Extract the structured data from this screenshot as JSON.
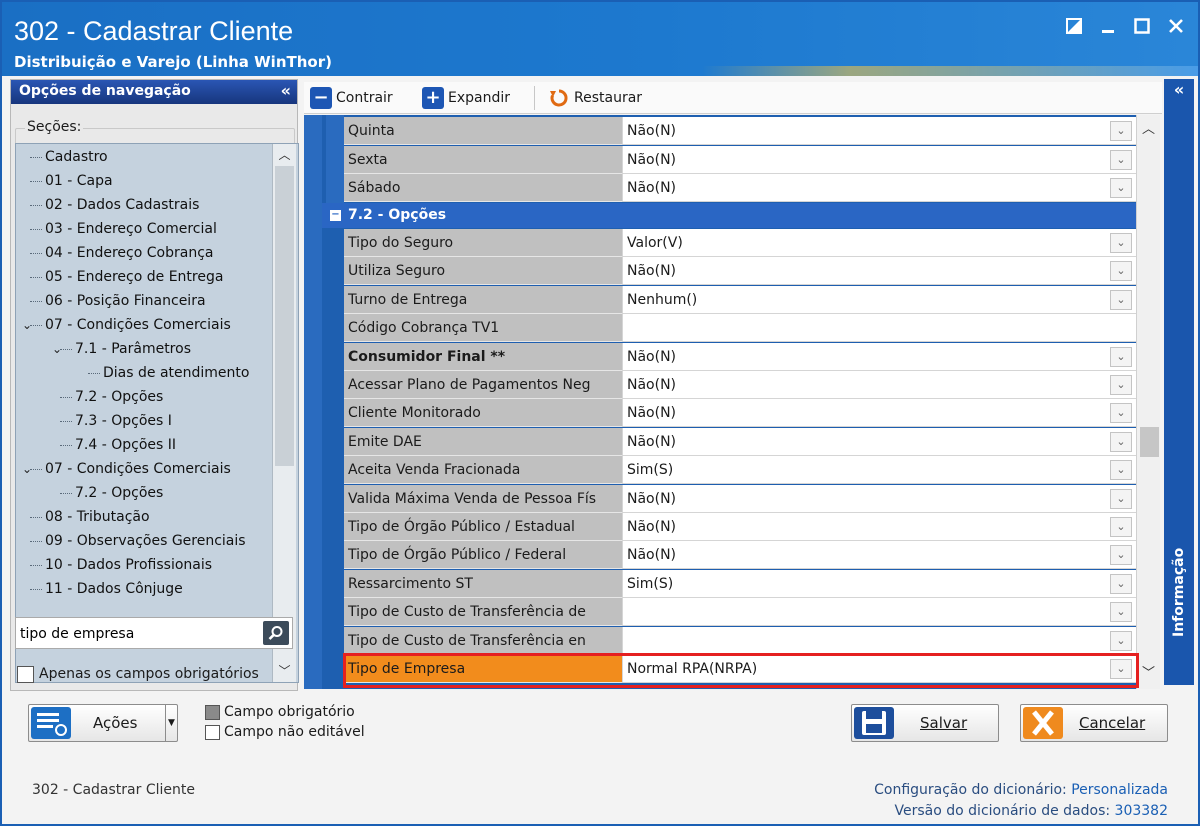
{
  "window": {
    "title": "302 - Cadastrar Cliente",
    "subtitle": "Distribuição e Varejo (Linha WinThor)"
  },
  "nav": {
    "header": "Opções de navegação",
    "collapse": "«",
    "sections_label": "Seções:",
    "tree": [
      {
        "label": "Cadastro",
        "level": 0
      },
      {
        "label": "01 - Capa",
        "level": 0
      },
      {
        "label": "02 - Dados Cadastrais",
        "level": 0
      },
      {
        "label": "03 - Endereço Comercial",
        "level": 0
      },
      {
        "label": "04 - Endereço Cobrança",
        "level": 0
      },
      {
        "label": "05 - Endereço de Entrega",
        "level": 0
      },
      {
        "label": "06 - Posição Financeira",
        "level": 0
      },
      {
        "label": "07 - Condições Comerciais",
        "level": 0,
        "expanded": true
      },
      {
        "label": "7.1 - Parâmetros",
        "level": 1,
        "expanded": true
      },
      {
        "label": "Dias de atendimento",
        "level": 2
      },
      {
        "label": "7.2 - Opções",
        "level": 1
      },
      {
        "label": "7.3 - Opções I",
        "level": 1
      },
      {
        "label": "7.4 - Opções II",
        "level": 1
      },
      {
        "label": "07 - Condições Comerciais",
        "level": 0,
        "expanded": true
      },
      {
        "label": "7.2 - Opções",
        "level": 1
      },
      {
        "label": "08 - Tributação",
        "level": 0
      },
      {
        "label": "09 - Observações Gerenciais",
        "level": 0
      },
      {
        "label": "10 - Dados Profissionais",
        "level": 0
      },
      {
        "label": "11 - Dados Cônjuge",
        "level": 0
      }
    ],
    "search_value": "tipo de empresa",
    "required_only_label": "Apenas os campos obrigatórios"
  },
  "toolbar": {
    "contract": "Contrair",
    "expand": "Expandir",
    "restore": "Restaurar"
  },
  "grid": {
    "top_rows": [
      {
        "label": "Quinta",
        "value": "Não(N)"
      },
      {
        "label": "Sexta",
        "value": "Não(N)"
      },
      {
        "label": "Sábado",
        "value": "Não(N)"
      }
    ],
    "category": "7.2 - Opções",
    "category_toggle": "−",
    "rows": [
      {
        "label": "Tipo do Seguro",
        "value": "Valor(V)",
        "dropdown": true
      },
      {
        "label": "Utiliza Seguro",
        "value": "Não(N)",
        "dropdown": true
      },
      {
        "label": "Turno de Entrega",
        "value": "Nenhum()",
        "dropdown": true
      },
      {
        "label": "Código Cobrança TV1",
        "value": "",
        "dropdown": false
      },
      {
        "label": "Consumidor Final **",
        "value": "Não(N)",
        "dropdown": true,
        "bold": true
      },
      {
        "label": "Acessar Plano de Pagamentos Neg",
        "value": "Não(N)",
        "dropdown": true
      },
      {
        "label": "Cliente Monitorado",
        "value": "Não(N)",
        "dropdown": true
      },
      {
        "label": "Emite DAE",
        "value": "Não(N)",
        "dropdown": true
      },
      {
        "label": "Aceita Venda Fracionada",
        "value": "Sim(S)",
        "dropdown": true
      },
      {
        "label": "Valida Máxima Venda de Pessoa Fís",
        "value": "Não(N)",
        "dropdown": true
      },
      {
        "label": "Tipo de Órgão Público / Estadual",
        "value": "Não(N)",
        "dropdown": true
      },
      {
        "label": "Tipo de Órgão Público / Federal",
        "value": "Não(N)",
        "dropdown": true
      },
      {
        "label": "Ressarcimento ST",
        "value": "Sim(S)",
        "dropdown": true
      },
      {
        "label": "Tipo de Custo de Transferência de",
        "value": "",
        "dropdown": true
      },
      {
        "label": "Tipo de Custo de Transferência en",
        "value": "",
        "dropdown": true
      },
      {
        "label": "Tipo de Empresa",
        "value": "Normal RPA(NRPA)",
        "dropdown": true,
        "selected": true
      }
    ]
  },
  "info_panel": {
    "label": "Informação",
    "collapse": "«"
  },
  "bottom": {
    "actions": "Ações",
    "legend_required": "Campo obrigatório",
    "legend_readonly": "Campo não editável",
    "save": "Salvar",
    "cancel": "Cancelar"
  },
  "status": {
    "app": "302 - Cadastrar Cliente",
    "dict_config_label": "Configuração do dicionário:",
    "dict_config_value": "Personalizada",
    "dict_version_label": "Versão do dicionário de dados:",
    "dict_version_value": "303382"
  },
  "colors": {
    "title_blue": "#1a6fc4",
    "nav_header": "#1d3f8f",
    "category": "#2a66c4",
    "selected_row": "#f28c1c",
    "highlight": "#e52020"
  }
}
